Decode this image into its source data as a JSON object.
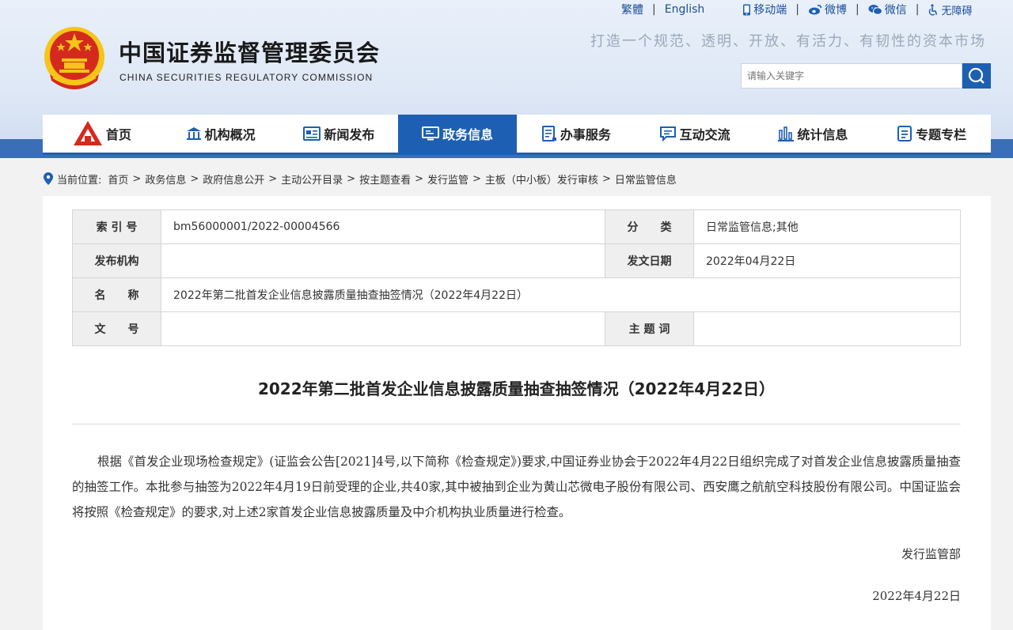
{
  "top_links": {
    "traditional": "繁體",
    "english": "English",
    "mobile": "移动端",
    "weibo": "微博",
    "wechat": "微信",
    "accessibility": "无障碍"
  },
  "header": {
    "org_name_cn": "中国证券监督管理委员会",
    "org_name_en": "CHINA SECURITIES REGULATORY COMMISSION",
    "slogan": "打造一个规范、透明、开放、有活力、有韧性的资本市场",
    "search_placeholder": "请输入关键字"
  },
  "nav": {
    "items": [
      {
        "label": "首页",
        "icon": "home-logo-icon"
      },
      {
        "label": "机构概况",
        "icon": "building-icon"
      },
      {
        "label": "新闻发布",
        "icon": "newspaper-icon"
      },
      {
        "label": "政务信息",
        "icon": "monitor-icon",
        "active": true
      },
      {
        "label": "办事服务",
        "icon": "document-icon"
      },
      {
        "label": "互动交流",
        "icon": "chat-icon"
      },
      {
        "label": "统计信息",
        "icon": "bar-chart-icon"
      },
      {
        "label": "专题专栏",
        "icon": "list-icon"
      }
    ]
  },
  "breadcrumb": {
    "prefix": "当前位置:",
    "items": [
      "首页",
      "政务信息",
      "政府信息公开",
      "主动公开目录",
      "按主题查看",
      "发行监管",
      "主板（中小板）发行审核",
      "日常监管信息"
    ]
  },
  "meta": {
    "index_label": "索 引 号",
    "index_value": "bm56000001/2022-00004566",
    "category_label": "分　　类",
    "category_value": "日常监管信息;其他",
    "publisher_label": "发布机构",
    "publisher_value": "",
    "date_label": "发文日期",
    "date_value": "2022年04月22日",
    "name_label": "名　　称",
    "name_value": "2022年第二批首发企业信息披露质量抽查抽签情况（2022年4月22日）",
    "docno_label": "文　　号",
    "docno_value": "",
    "keywords_label": "主 题 词",
    "keywords_value": ""
  },
  "article": {
    "title": "2022年第二批首发企业信息披露质量抽查抽签情况（2022年4月22日）",
    "body": "根据《首发企业现场检查规定》(证监会公告[2021]4号,以下简称《检查规定》)要求,中国证券业协会于2022年4月22日组织完成了对首发企业信息披露质量抽查的抽签工作。本批参与抽签为2022年4月19日前受理的企业,共40家,其中被抽到企业为黄山芯微电子股份有限公司、西安鹰之航航空科技股份有限公司。中国证监会将按照《检查规定》的要求,对上述2家首发企业信息披露质量及中介机构执业质量进行检查。",
    "department": "发行监管部",
    "date": "2022年4月22日"
  },
  "colors": {
    "brand_blue": "#1d5fb3",
    "emblem_red": "#d42a1e",
    "emblem_gold": "#f5c518"
  }
}
